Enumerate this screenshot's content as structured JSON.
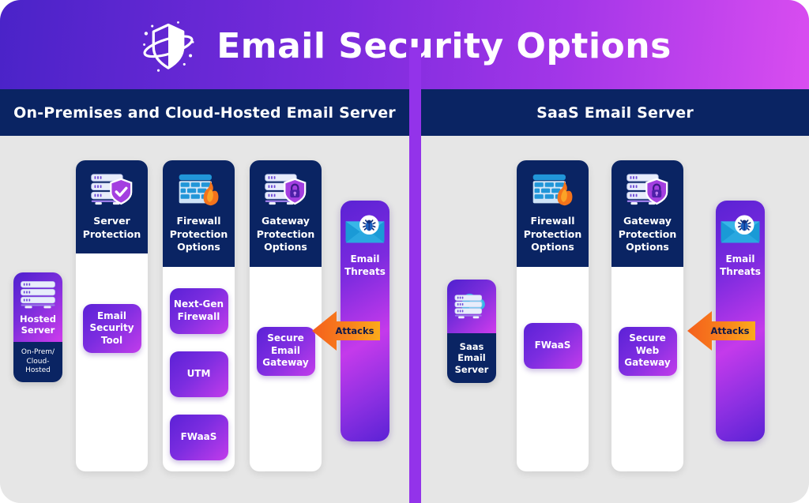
{
  "header": {
    "title": "Email Security Options",
    "logo_icon": "shield-orbit-icon",
    "gradient_from": "#4a23c8",
    "gradient_to": "#d94df0"
  },
  "panels": {
    "left_bar_label": "On-Premises and Cloud-Hosted Email Server",
    "right_bar_label": "SaaS Email Server",
    "bar_color": "#0a2463",
    "divider_color": "#9333ea"
  },
  "left_panel": {
    "server_card": {
      "top_label": "Hosted\nServer",
      "bottom_label": "On-Prem/\nCloud-Hosted",
      "icon": "server-rack-icon"
    },
    "columns": [
      {
        "title": "Server\nProtection",
        "icon": "server-shield-check-icon",
        "items": [
          "Email\nSecurity\nTool"
        ]
      },
      {
        "title": "Firewall\nProtection\nOptions",
        "icon": "firewall-flame-icon",
        "items": [
          "Next-Gen\nFirewall",
          "UTM",
          "FWaaS"
        ]
      },
      {
        "title": "Gateway\nProtection\nOptions",
        "icon": "server-shield-lock-icon",
        "items": [
          "Secure\nEmail\nGateway"
        ]
      }
    ],
    "threats": {
      "label": "Email\nThreats",
      "icon": "envelope-bug-icon",
      "attack_label": "Attacks"
    }
  },
  "right_panel": {
    "server_card": {
      "top_label": "",
      "bottom_label": "Saas\nEmail\nServer",
      "icon": "cloud-server-icon"
    },
    "columns": [
      {
        "title": "Firewall\nProtection\nOptions",
        "icon": "firewall-flame-icon",
        "items": [
          "FWaaS"
        ]
      },
      {
        "title": "Gateway\nProtection\nOptions",
        "icon": "server-shield-lock-icon",
        "items": [
          "Secure\nWeb\nGateway"
        ]
      }
    ],
    "threats": {
      "label": "Email\nThreats",
      "icon": "envelope-bug-icon",
      "attack_label": "Attacks"
    }
  },
  "colors": {
    "background": "#e6e6e6",
    "navy": "#0a2463",
    "purple_accent": "#9333ea",
    "pill_gradient_from": "#5b21d6",
    "pill_gradient_to": "#c23ceb",
    "attack_orange_from": "#f4661e",
    "attack_orange_to": "#faa81c",
    "card_white": "#ffffff"
  }
}
